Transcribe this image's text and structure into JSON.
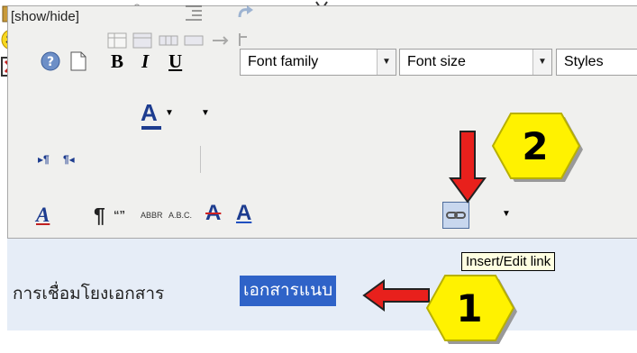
{
  "header": {
    "show_hide": "[show/hide]"
  },
  "toolbar1": {
    "font_family": "Font family",
    "font_size": "Font size",
    "styles": "Styles",
    "bold": "B",
    "italic": "I",
    "underline": "U"
  },
  "toolbar4": {
    "quote_label": "“”",
    "abbr_label": "ABBR",
    "acronym_label": "A.B.C."
  },
  "editor": {
    "text": "การเชื่อมโยงเอกสาร",
    "selected_text": "เอกสารแนบ"
  },
  "tooltip": {
    "text": "Insert/Edit link"
  },
  "callouts": [
    {
      "number": "1"
    },
    {
      "number": "2"
    }
  ],
  "colors": {
    "arrow": "#e8201c",
    "badge": "#fff200",
    "selection": "#2f63c8"
  }
}
